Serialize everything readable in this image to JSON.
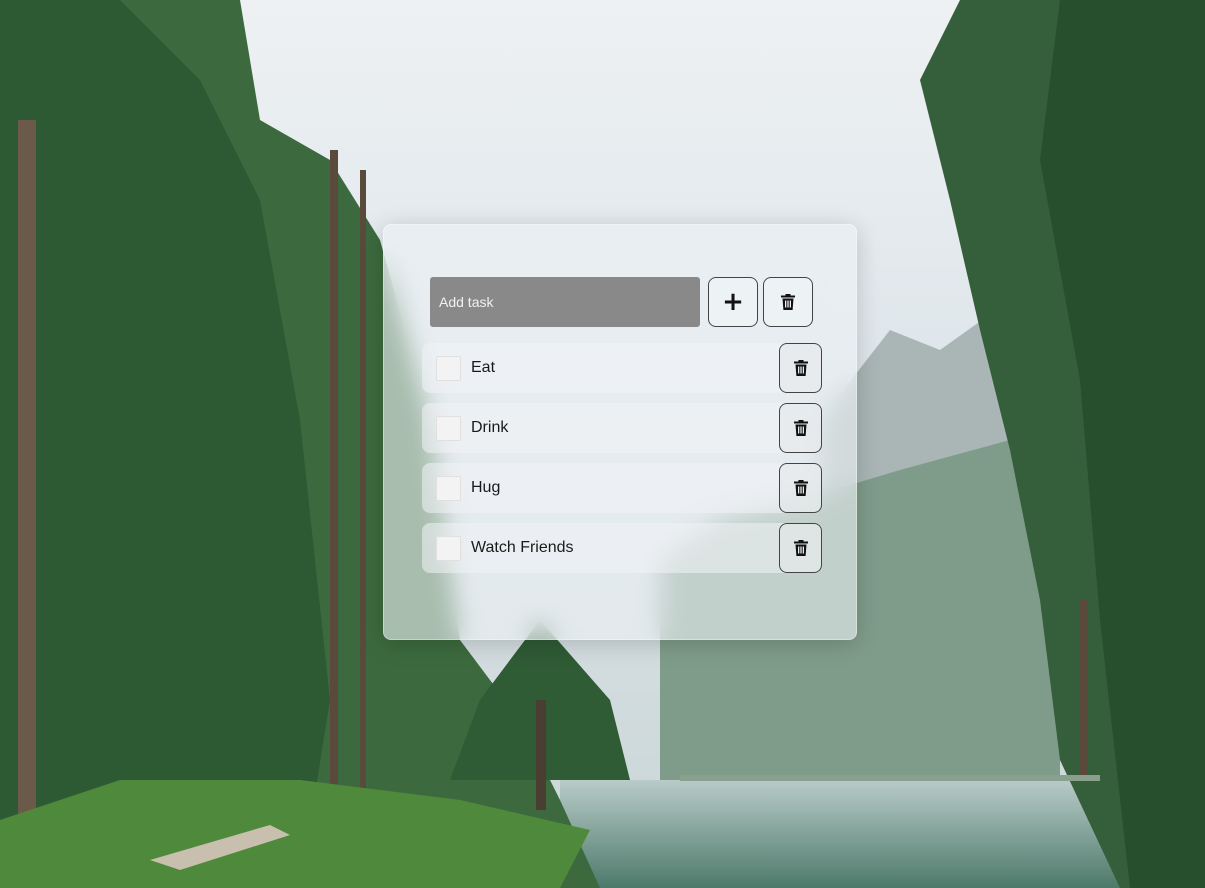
{
  "input": {
    "placeholder": "Add task",
    "value": ""
  },
  "buttons": {
    "add_icon": "plus-icon",
    "clear_icon": "trash-icon"
  },
  "tasks": [
    {
      "label": "Eat",
      "checked": false
    },
    {
      "label": "Drink",
      "checked": false
    },
    {
      "label": "Hug",
      "checked": false
    },
    {
      "label": "Watch Friends",
      "checked": false
    }
  ],
  "colors": {
    "panel": "#ebf0f3",
    "input_bg": "#787878",
    "border": "#444444"
  }
}
